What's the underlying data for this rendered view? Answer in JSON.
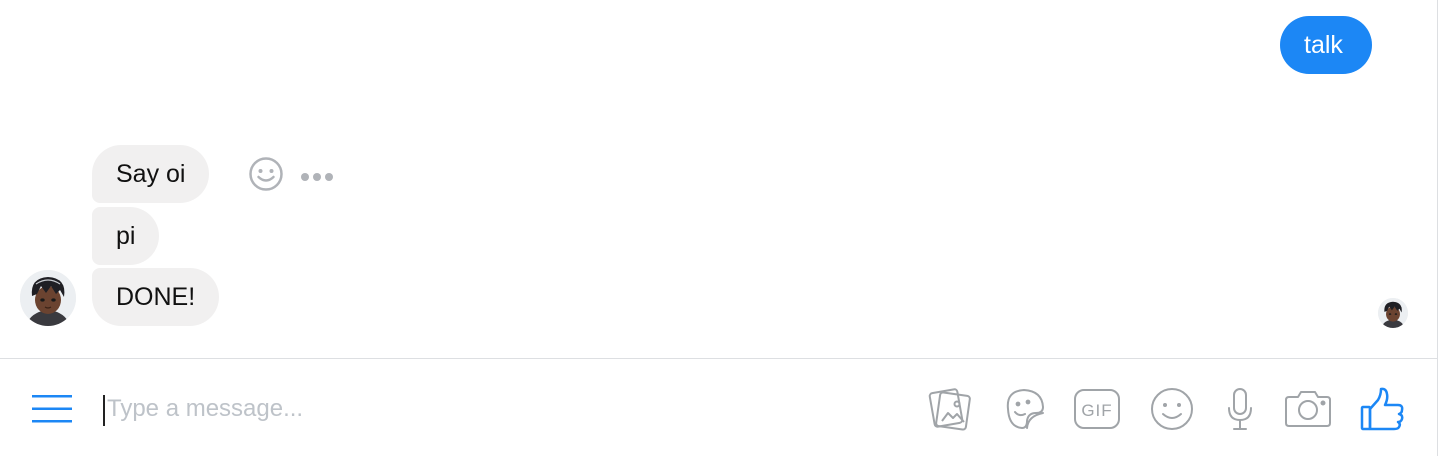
{
  "thread": {
    "outgoing_messages": [
      {
        "text": "talk"
      }
    ],
    "incoming_messages": [
      {
        "text": "Say oi"
      },
      {
        "text": "pi"
      },
      {
        "text": "DONE!"
      }
    ],
    "message_actions": [
      "smiley-icon",
      "more-dots-icon"
    ],
    "sender_avatar": "avatar",
    "seen_indicator": "avatar",
    "colors": {
      "outgoing_bubble": "#1c87f5",
      "incoming_bubble": "#f1f0f0",
      "accent": "#1c87f5",
      "icon_gray": "#a0a4a8"
    }
  },
  "composer": {
    "placeholder": "Type a message...",
    "value": "",
    "menu_icon": "hamburger-menu-icon",
    "tools": [
      "image-upload-icon",
      "sticker-icon",
      "gif-icon",
      "emoji-icon",
      "microphone-icon",
      "camera-icon",
      "thumbs-up-icon"
    ]
  }
}
